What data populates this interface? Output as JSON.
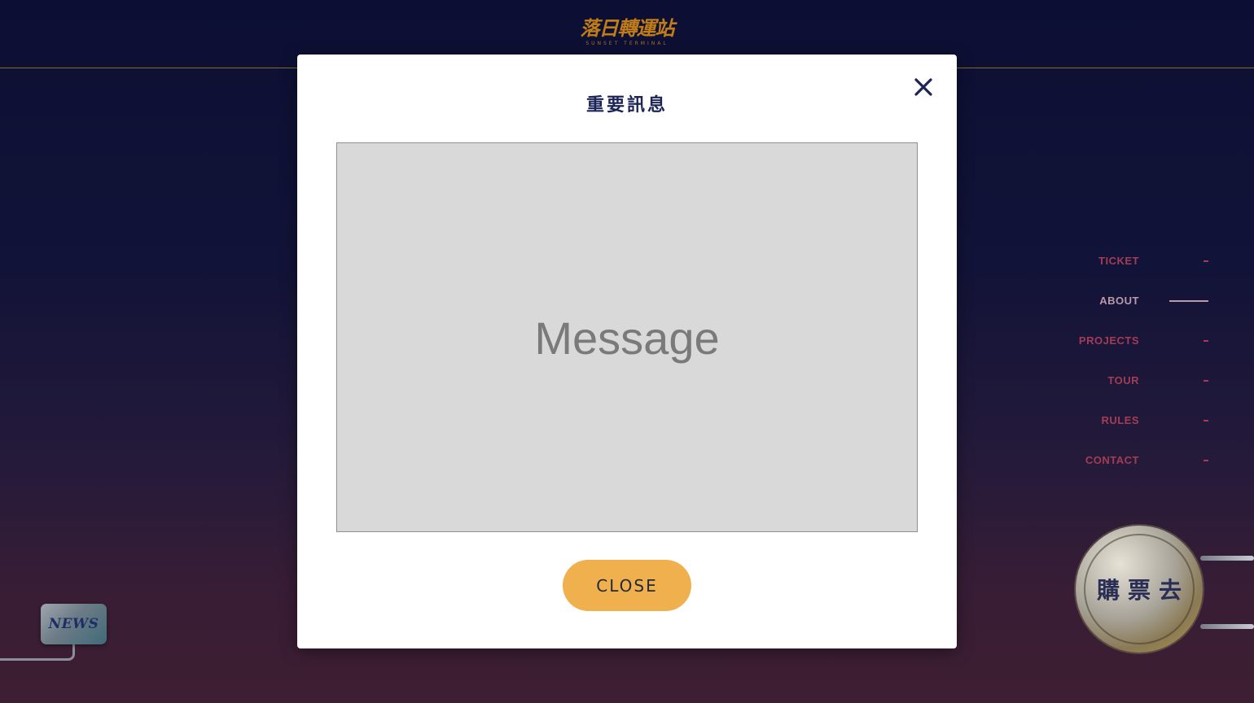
{
  "header": {
    "logo_text": "落日轉運站",
    "logo_subtext": "SUNSET TERMINAL"
  },
  "nav": {
    "items": [
      {
        "label": "TICKET",
        "active": false
      },
      {
        "label": "ABOUT",
        "active": true
      },
      {
        "label": "PROJECTS",
        "active": false
      },
      {
        "label": "TOUR",
        "active": false
      },
      {
        "label": "RULES",
        "active": false
      },
      {
        "label": "CONTACT",
        "active": false
      }
    ]
  },
  "news_badge": {
    "label": "NEWS"
  },
  "buy_ticket": {
    "label": "購票去"
  },
  "modal": {
    "title": "重要訊息",
    "message_placeholder": "Message",
    "close_button_label": "CLOSE",
    "close_icon": "close-icon"
  },
  "colors": {
    "background_top": "#0c0f33",
    "background_bottom": "#3e1e32",
    "accent_gold": "#f0b04d",
    "nav_inactive": "#a33c55",
    "nav_active": "#b99aa8",
    "title_navy": "#1c2456"
  }
}
